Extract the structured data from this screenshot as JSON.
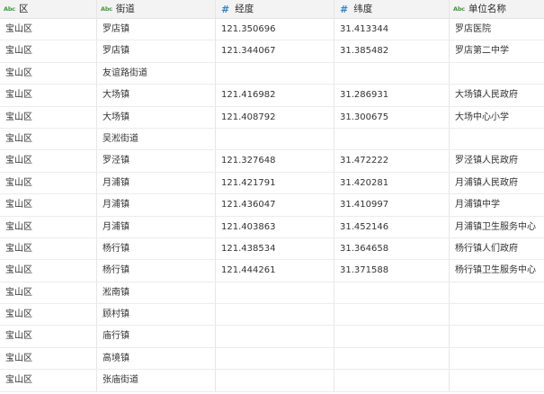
{
  "columns": [
    {
      "label": "区",
      "type_icon": "Abc"
    },
    {
      "label": "街道",
      "type_icon": "Abc"
    },
    {
      "label": "经度",
      "type_icon": "#"
    },
    {
      "label": "纬度",
      "type_icon": "#"
    },
    {
      "label": "单位名称",
      "type_icon": "Abc"
    }
  ],
  "rows": [
    [
      "宝山区",
      "罗店镇",
      "121.350696",
      "31.413344",
      "罗店医院"
    ],
    [
      "宝山区",
      "罗店镇",
      "121.344067",
      "31.385482",
      "罗店第二中学"
    ],
    [
      "宝山区",
      "友谊路街道",
      "",
      "",
      ""
    ],
    [
      "宝山区",
      "大场镇",
      "121.416982",
      "31.286931",
      "大场镇人民政府"
    ],
    [
      "宝山区",
      "大场镇",
      "121.408792",
      "31.300675",
      "大场中心小学"
    ],
    [
      "宝山区",
      "吴淞街道",
      "",
      "",
      ""
    ],
    [
      "宝山区",
      "罗泾镇",
      "121.327648",
      "31.472222",
      "罗泾镇人民政府"
    ],
    [
      "宝山区",
      "月浦镇",
      "121.421791",
      "31.420281",
      "月浦镇人民政府"
    ],
    [
      "宝山区",
      "月浦镇",
      "121.436047",
      "31.410997",
      "月浦镇中学"
    ],
    [
      "宝山区",
      "月浦镇",
      "121.403863",
      "31.452146",
      "月浦镇卫生服务中心"
    ],
    [
      "宝山区",
      "杨行镇",
      "121.438534",
      "31.364658",
      "杨行镇人们政府"
    ],
    [
      "宝山区",
      "杨行镇",
      "121.444261",
      "31.371588",
      "杨行镇卫生服务中心"
    ],
    [
      "宝山区",
      "淞南镇",
      "",
      "",
      ""
    ],
    [
      "宝山区",
      "顾村镇",
      "",
      "",
      ""
    ],
    [
      "宝山区",
      "庙行镇",
      "",
      "",
      ""
    ],
    [
      "宝山区",
      "高境镇",
      "",
      "",
      ""
    ],
    [
      "宝山区",
      "张庙街道",
      "",
      "",
      ""
    ]
  ],
  "colors": {
    "text_type_icon": "#3d9a3d",
    "number_type_icon": "#2f86c9",
    "grid_line": "#ececec"
  }
}
